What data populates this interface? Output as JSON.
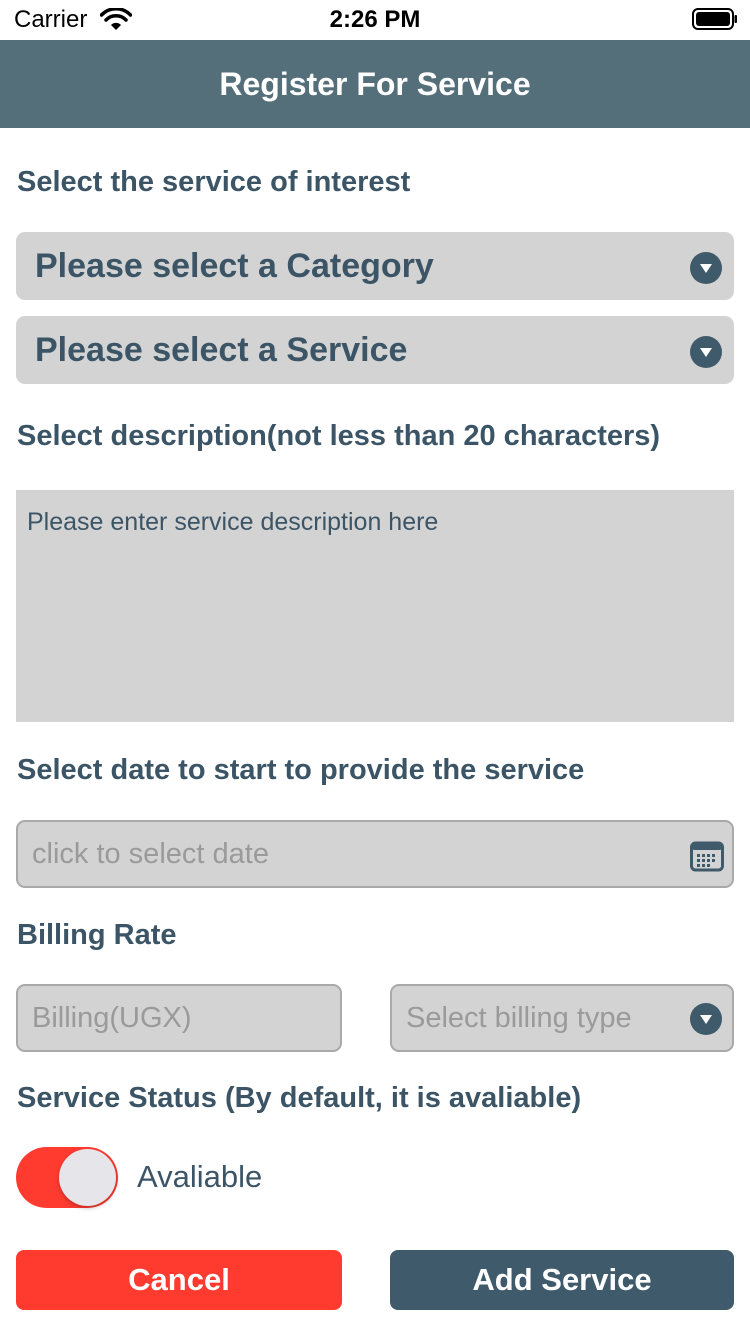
{
  "status_bar": {
    "carrier": "Carrier",
    "time": "2:26 PM",
    "wifi_icon": "wifi-icon",
    "battery_icon": "battery-icon"
  },
  "navbar": {
    "title": "Register For Service"
  },
  "service_section": {
    "label": "Select the service of interest",
    "category_select": {
      "value": "Please select a Category",
      "icon": "chevron-down-icon"
    },
    "service_select": {
      "value": "Please select a Service",
      "icon": "chevron-down-icon"
    }
  },
  "description_section": {
    "label": "Select description(not less than 20 characters)",
    "placeholder": "Please enter service description here"
  },
  "date_section": {
    "label": "Select date to start to provide the service",
    "placeholder": "click to select date",
    "icon": "calendar-icon"
  },
  "billing_section": {
    "label": "Billing Rate",
    "amount_placeholder": "Billing(UGX)",
    "type_placeholder": "Select billing type",
    "icon": "chevron-down-icon"
  },
  "status_section": {
    "label": "Service Status  (By default, it is avaliable)",
    "toggle_on": true,
    "toggle_label": "Avaliable"
  },
  "actions": {
    "cancel_label": "Cancel",
    "add_label": "Add Service"
  },
  "colors": {
    "navbar": "#546e7a",
    "text": "#3c5566",
    "field_bg": "#d3d3d3",
    "danger": "#ff3b30",
    "primary": "#3f5a6a"
  }
}
